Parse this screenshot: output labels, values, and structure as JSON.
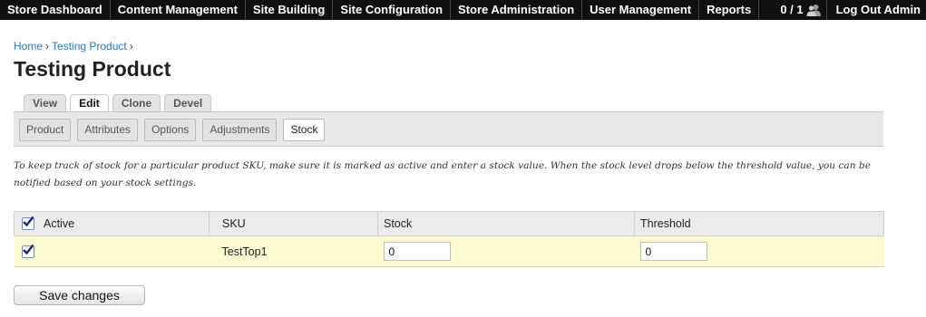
{
  "admin_menu": {
    "items": [
      {
        "label": "Store Dashboard"
      },
      {
        "label": "Content Management"
      },
      {
        "label": "Site Building"
      },
      {
        "label": "Site Configuration"
      },
      {
        "label": "Store Administration"
      },
      {
        "label": "User Management"
      },
      {
        "label": "Reports"
      }
    ],
    "user_count": "0 / 1",
    "user_count_icon": "users-icon",
    "logout_label": "Log Out Admin"
  },
  "breadcrumb": {
    "items": [
      {
        "label": "Home"
      },
      {
        "label": "Testing Product"
      }
    ],
    "separator": "›"
  },
  "page_title": "Testing Product",
  "primary_tabs": [
    {
      "label": "View",
      "active": false
    },
    {
      "label": "Edit",
      "active": true
    },
    {
      "label": "Clone",
      "active": false
    },
    {
      "label": "Devel",
      "active": false
    }
  ],
  "secondary_tabs": [
    {
      "label": "Product",
      "active": false
    },
    {
      "label": "Attributes",
      "active": false
    },
    {
      "label": "Options",
      "active": false
    },
    {
      "label": "Adjustments",
      "active": false
    },
    {
      "label": "Stock",
      "active": true
    }
  ],
  "description": "To keep track of stock for a particular product SKU, make sure it is marked as active and enter a stock value. When the stock level drops below the threshold value, you can be notified based on your stock settings.",
  "stock_table": {
    "headers": {
      "active": "Active",
      "sku": "SKU",
      "stock": "Stock",
      "threshold": "Threshold"
    },
    "select_all_checked": true,
    "rows": [
      {
        "active": true,
        "sku": "TestTop1",
        "stock": "0",
        "threshold": "0"
      }
    ]
  },
  "save_button_label": "Save changes",
  "colors": {
    "admin_bar_bg": "#101010",
    "link": "#2a7ab8",
    "row_highlight": "#fdfad2",
    "header_bg": "#ebebeb"
  }
}
